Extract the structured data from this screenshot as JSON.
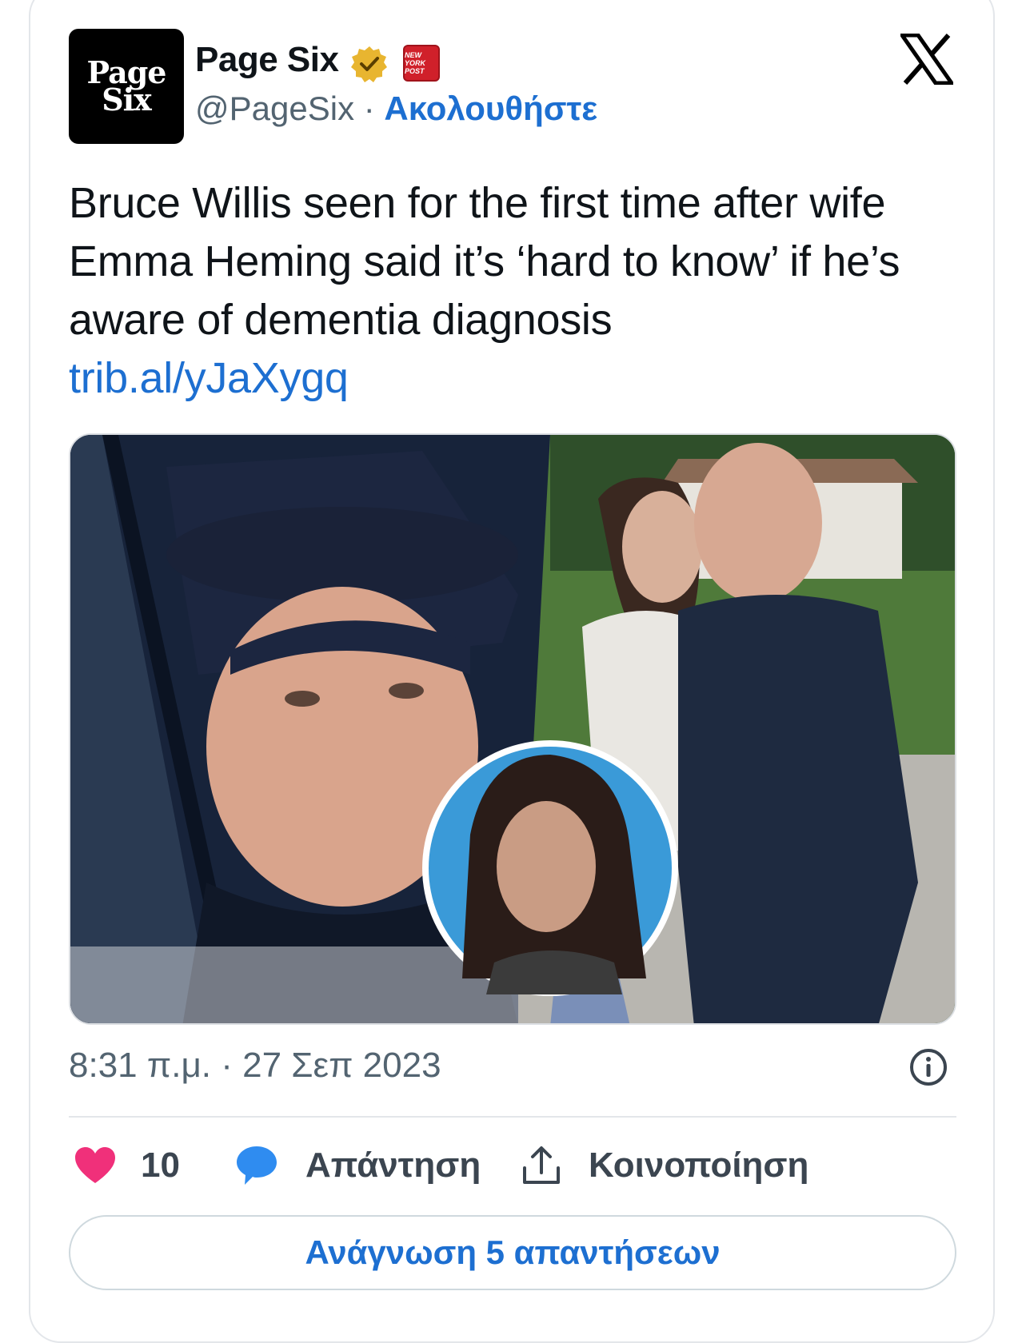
{
  "account": {
    "avatar_line1": "Page",
    "avatar_line2": "Six",
    "name": "Page Six",
    "badge_text": "NEW YORK POST",
    "handle": "@PageSix",
    "separator": "·",
    "follow_label": "Ακολουθήστε"
  },
  "tweet": {
    "text": "Bruce Willis seen for the first time after wife Emma Heming said it’s ‘hard to know’ if he’s aware of dementia diagnosis",
    "link": "trib.al/yJaXygq",
    "timestamp": "8:31 π.μ. · 27 Σεπ 2023"
  },
  "actions": {
    "likes": "10",
    "reply_label": "Απάντηση",
    "share_label": "Κοινοποίηση"
  },
  "read_replies_label": "Ανάγνωση 5 απαντήσεων",
  "colors": {
    "link_blue": "#1d6fd1",
    "heart": "#f0307a",
    "bubble": "#2f8cf0",
    "verified": "#e8b530"
  },
  "icons": [
    "verified-badge-icon",
    "x-logo-icon",
    "info-icon",
    "heart-icon",
    "reply-bubble-icon",
    "share-icon"
  ]
}
